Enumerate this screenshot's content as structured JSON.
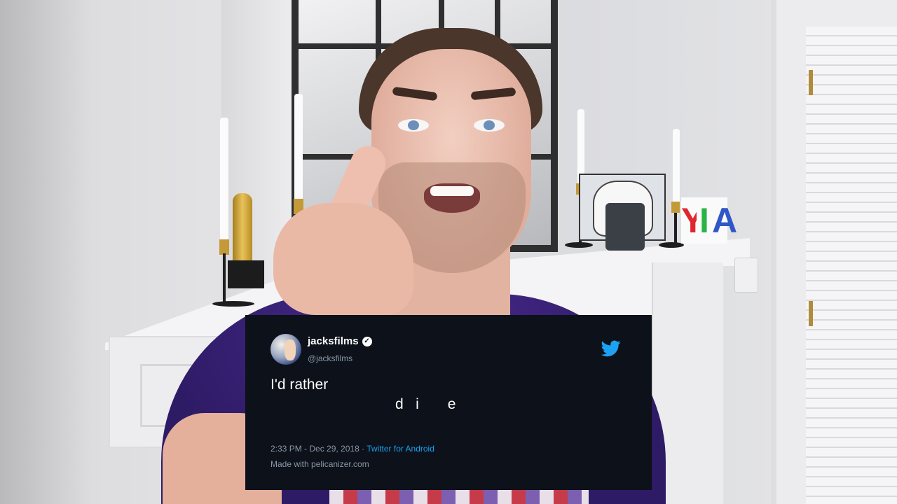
{
  "tweet": {
    "display_name": "jacksfilms",
    "handle": "@jacksfilms",
    "text_line1": "I'd rather",
    "text_line2": "d   i       e",
    "timestamp": "2:33 PM - Dec 29, 2018 · ",
    "source": "Twitter for Android",
    "footer": "Made with pelicanizer.com",
    "icons": {
      "avatar": "profile-avatar",
      "verified": "verified-badge-icon",
      "brand": "twitter-bird-icon"
    },
    "colors": {
      "card_bg": "#0c111a",
      "text": "#ffffff",
      "muted": "#8b98a5",
      "link": "#1da1f2"
    }
  },
  "scene": {
    "letters": [
      "Y",
      "I",
      "A"
    ],
    "letter_colors": [
      "#e0262f",
      "#2bb34a",
      "#2f57c8"
    ]
  }
}
